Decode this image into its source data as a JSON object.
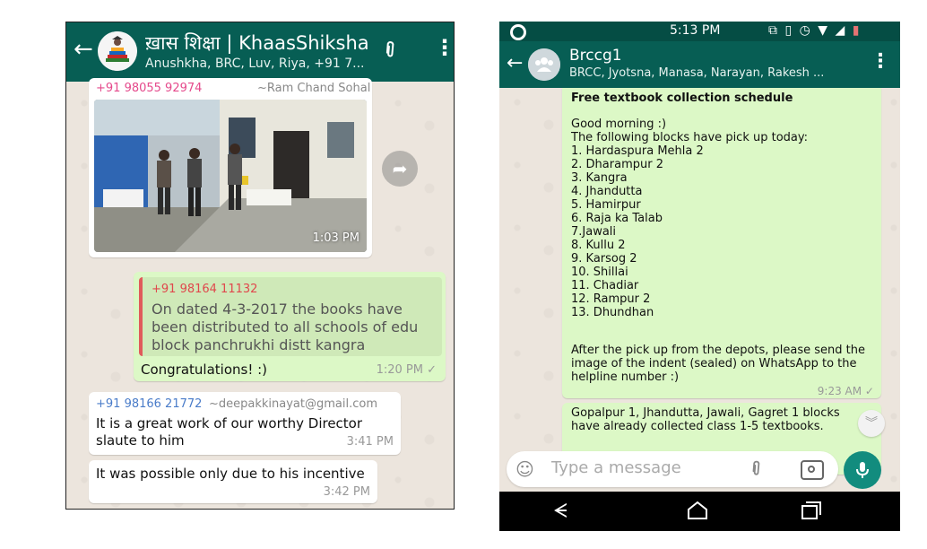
{
  "left_chat": {
    "title": "ख़ास शिक्षा | KhaasShiksha",
    "participants": "Anushkha, BRC, Luv, Riya, +91 7...",
    "messages": {
      "m1": {
        "phone": "+91 98055 92974",
        "name": "~Ram Chand Sohal",
        "time": "1:03 PM"
      },
      "m2": {
        "quoted_phone": "+91 98164 11132",
        "quoted_text": "On dated 4-3-2017 the books have been distributed to all schools of edu block panchrukhi distt kangra",
        "text": "Congratulations! :)",
        "time": "1:20 PM ✓"
      },
      "m3": {
        "phone": "+91 98166 21772",
        "email": "~deepakkinayat@gmail.com",
        "text": "It is a great work of our worthy Director slaute to him",
        "time": "3:41 PM"
      },
      "m4": {
        "text": "It was possible  only due to his incentive",
        "time": "3:42 PM"
      }
    }
  },
  "right_chat": {
    "status_time": "5:13 PM",
    "title": "Brccg1",
    "participants": "BRCC, Jyotsna, Manasa, Narayan, Rakesh ...",
    "message1": {
      "title": "Free textbook collection schedule",
      "greeting": "Good morning :)",
      "intro": "The following blocks have pick up today:",
      "blocks": [
        "1. Hardaspura Mehla 2",
        "2. Dharampur 2",
        "3. Kangra",
        "4. Jhandutta",
        "5. Hamirpur",
        "6. Raja ka Talab",
        "7.Jawali",
        "8. Kullu 2",
        "9. Karsog 2",
        "10. Shillai",
        "11. Chadiar",
        "12. Rampur 2",
        "13. Dhundhan"
      ],
      "footer": "After the pick up from the depots, please send the image of the indent (sealed) on WhatsApp to the helpline number :)",
      "time": "9:23 AM ✓"
    },
    "message2": {
      "text": "Gopalpur 1, Jhandutta, Jawali, Gagret 1 blocks have already collected class 1-5 textbooks."
    },
    "input_placeholder": "Type a message"
  },
  "icons": {
    "back": "back-arrow-icon",
    "attach": "paperclip-icon",
    "menu": "more-vert-icon",
    "share": "forward-icon",
    "emoji": "emoji-icon",
    "camera": "camera-icon",
    "mic": "mic-icon",
    "scroll_down": "chevron-down-icon"
  },
  "colors": {
    "header": "#075e54",
    "status_bar": "#054d44",
    "outgoing_bubble": "#dcf8c6",
    "incoming_bubble": "#ffffff",
    "chat_bg": "#ece5dd",
    "mic_button": "#128c7e"
  }
}
